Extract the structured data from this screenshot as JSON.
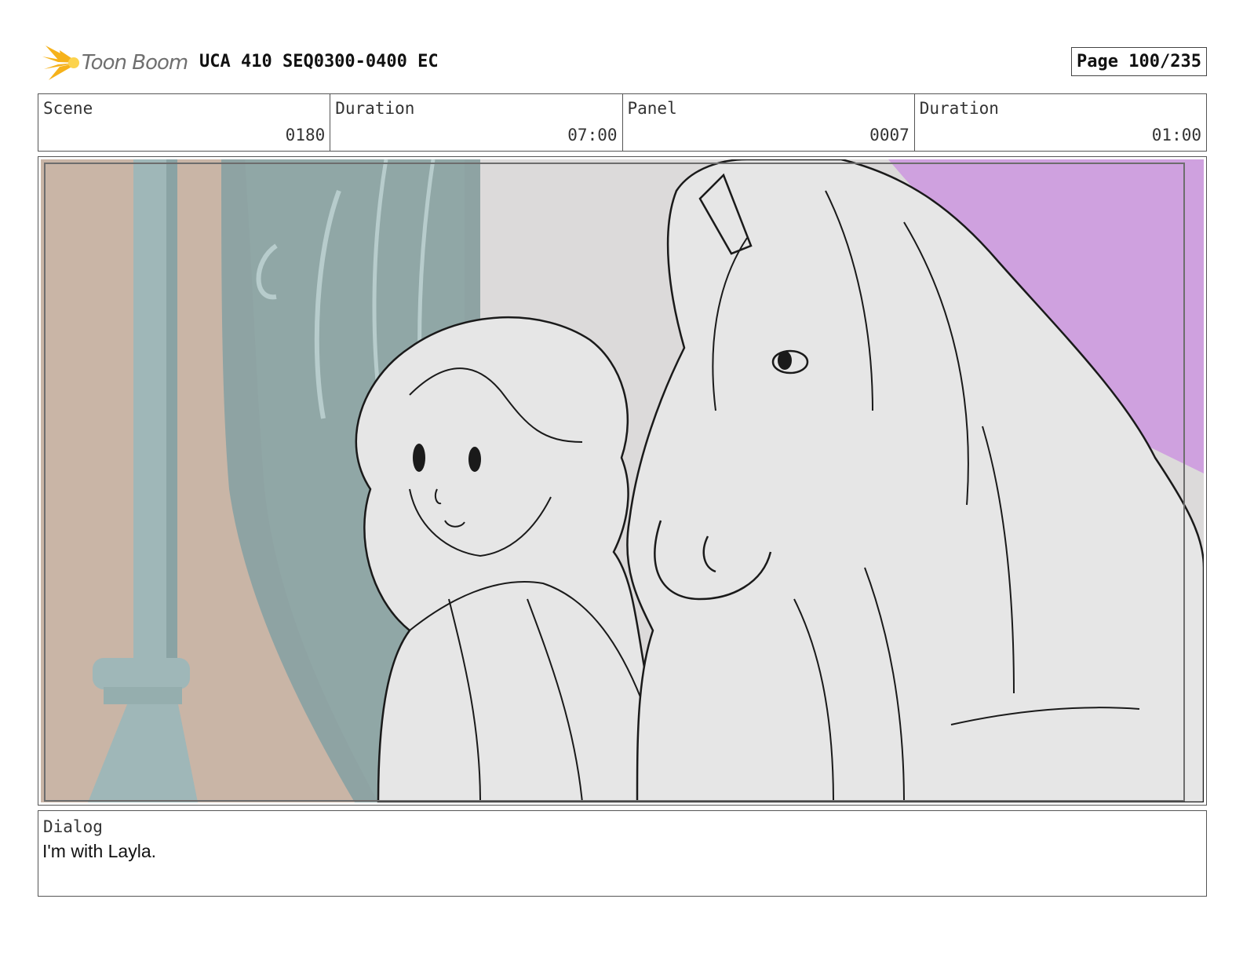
{
  "header": {
    "logo_text": "Toon Boom",
    "title": "UCA 410 SEQ0300-0400 EC",
    "page": "Page 100/235"
  },
  "info": {
    "scene_label": "Scene",
    "scene_value": "0180",
    "scene_duration_label": "Duration",
    "scene_duration_value": "07:00",
    "panel_label": "Panel",
    "panel_value": "0007",
    "panel_duration_label": "Duration",
    "panel_duration_value": "01:00"
  },
  "dialog": {
    "label": "Dialog",
    "text": "I'm with Layla."
  },
  "colors": {
    "accent_logo": "#f6b21a",
    "sky_purple": "#cfa1df",
    "pillar_teal": "#9fb7b8",
    "wall_tan": "#c9b5a6",
    "sketch_fill": "#e6e6e6"
  }
}
